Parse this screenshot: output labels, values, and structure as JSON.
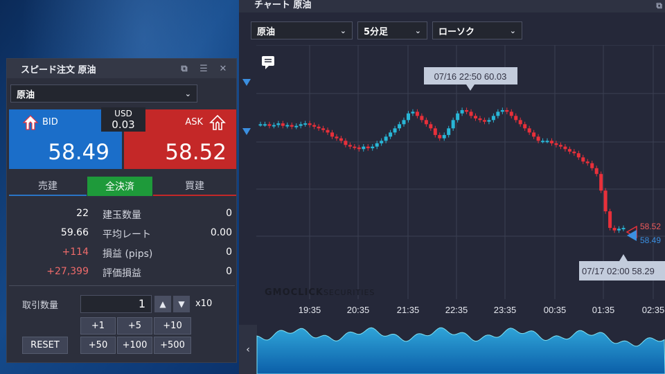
{
  "speed_order": {
    "title": "スピード注文 原油",
    "symbol": "原油",
    "bid": {
      "label": "BID",
      "price": "58.49"
    },
    "ask": {
      "label": "ASK",
      "price": "58.52"
    },
    "spread": {
      "currency": "USD",
      "value": "0.03"
    },
    "modes": {
      "sell": "売建",
      "close_all": "全決済",
      "buy": "買建"
    },
    "stats": [
      {
        "sell": "22",
        "label": "建玉数量",
        "buy": "0"
      },
      {
        "sell": "59.66",
        "label": "平均レート",
        "buy": "0.00"
      },
      {
        "sell": "+114",
        "label": "損益 (pips)",
        "buy": "0"
      },
      {
        "sell": "+27,399",
        "label": "評価損益",
        "buy": "0"
      }
    ],
    "quantity": {
      "label": "取引数量",
      "value": "1",
      "unit": "x10"
    },
    "increment_buttons": [
      "+1",
      "+5",
      "+10",
      "+50",
      "+100",
      "+500"
    ],
    "reset_label": "RESET"
  },
  "chart_window": {
    "title": "チャート 原油",
    "symbol": "原油",
    "interval": "5分足",
    "chart_type": "ローソク",
    "high_marker": "07/16 22:50 60.03",
    "low_marker": "07/17 02:00 58.29",
    "ask_tag": "58.52",
    "bid_tag": "58.49",
    "watermark_brand": "GMOCLICK",
    "watermark_suffix": "SECURITIES"
  },
  "colors": {
    "up": "#29b6d6",
    "down": "#e8303a",
    "bid": "#1b6ec9",
    "ask": "#c42828",
    "close_all": "#1e9a3a"
  },
  "icons": [
    "popout-icon",
    "menu-icon",
    "close-icon",
    "chevron-down-icon",
    "bid-arrow-icon",
    "ask-arrow-icon",
    "comment-icon",
    "triangle-marker-icon",
    "chevron-left-icon"
  ],
  "chart_data": {
    "type": "candlestick",
    "x_ticks": [
      "19:35",
      "20:35",
      "21:35",
      "22:35",
      "23:35",
      "00:35",
      "01:35",
      "02:35"
    ],
    "price_markers": {
      "high": 60.03,
      "low": 58.29,
      "ask": 58.52,
      "bid": 58.49
    },
    "series": [
      {
        "name": "原油",
        "close_approx": [
          59.75,
          59.75,
          59.73,
          59.74,
          59.76,
          59.73,
          59.74,
          59.72,
          59.73,
          59.75,
          59.76,
          59.74,
          59.72,
          59.7,
          59.68,
          59.65,
          59.6,
          59.58,
          59.55,
          59.5,
          59.48,
          59.47,
          59.45,
          59.48,
          59.46,
          59.48,
          59.52,
          59.55,
          59.6,
          59.65,
          59.7,
          59.75,
          59.8,
          59.88,
          59.9,
          59.85,
          59.8,
          59.75,
          59.7,
          59.62,
          59.58,
          59.62,
          59.7,
          59.8,
          59.88,
          59.92,
          59.9,
          59.85,
          59.82,
          59.8,
          59.78,
          59.8,
          59.85,
          59.9,
          59.92,
          59.9,
          59.85,
          59.8,
          59.75,
          59.7,
          59.65,
          59.6,
          59.55,
          59.55,
          59.55,
          59.52,
          59.5,
          59.48,
          59.45,
          59.42,
          59.4,
          59.35,
          59.3,
          59.28,
          59.22,
          59.15,
          58.95,
          58.7,
          58.5,
          58.47,
          58.49,
          58.5
        ]
      }
    ]
  }
}
